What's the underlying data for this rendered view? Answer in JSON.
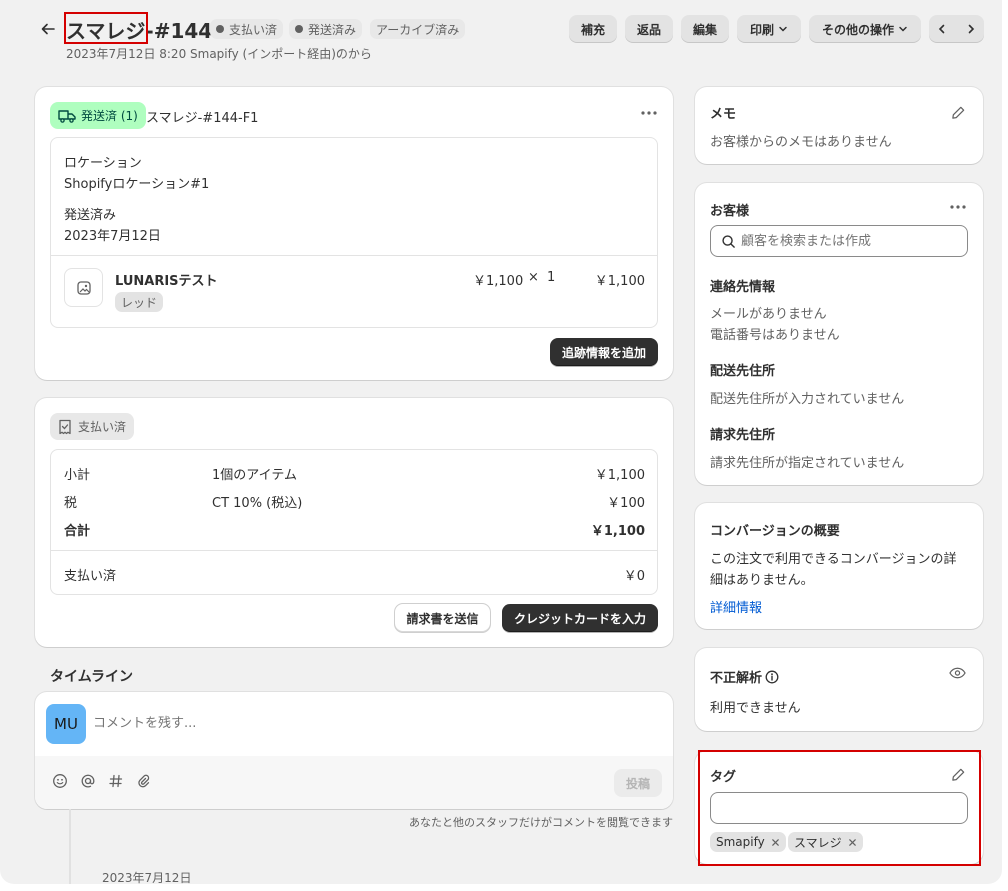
{
  "header": {
    "title_part1": "スマレジ",
    "title_part2": "-#144",
    "badges": [
      "支払い済",
      "発送済み",
      "アーカイブ済み"
    ],
    "subtitle": "2023年7月12日 8:20 Smapify (インポート経由)のから",
    "actions": {
      "restock": "補充",
      "return": "返品",
      "edit": "編集",
      "print": "印刷",
      "more": "その他の操作"
    }
  },
  "fulfillment": {
    "status_badge": "発送済 (1)",
    "fulfillment_id": "スマレジ-#144-F1",
    "location_label": "ロケーション",
    "location_value": "Shopifyロケーション#1",
    "shipped_label": "発送済み",
    "shipped_date": "2023年7月12日",
    "item": {
      "name": "LUNARISテスト",
      "variant": "レッド",
      "price": "￥1,100",
      "times": "×",
      "qty": "1",
      "total": "￥1,100"
    },
    "add_tracking": "追跡情報を追加"
  },
  "payment": {
    "status_badge": "支払い済",
    "rows": [
      {
        "label": "小計",
        "desc": "1個のアイテム",
        "amount": "￥1,100"
      },
      {
        "label": "税",
        "desc": "CT 10% (税込)",
        "amount": "￥100"
      },
      {
        "label": "合計",
        "desc": "",
        "amount": "￥1,100"
      }
    ],
    "paid_label": "支払い済",
    "paid_amount": "￥0",
    "send_invoice": "請求書を送信",
    "enter_card": "クレジットカードを入力"
  },
  "timeline": {
    "title": "タイムライン",
    "avatar_initials": "MU",
    "comment_placeholder": "コメントを残す...",
    "post": "投稿",
    "note": "あなたと他のスタッフだけがコメントを閲覧できます",
    "date": "2023年7月12日"
  },
  "memo": {
    "title": "メモ",
    "text": "お客様からのメモはありません"
  },
  "customer": {
    "title": "お客様",
    "search_placeholder": "顧客を検索または作成",
    "contact_title": "連絡先情報",
    "no_email": "メールがありません",
    "no_phone": "電話番号はありません",
    "shipping_title": "配送先住所",
    "shipping_text": "配送先住所が入力されていません",
    "billing_title": "請求先住所",
    "billing_text": "請求先住所が指定されていません"
  },
  "conversion": {
    "title": "コンバージョンの概要",
    "text_line1": "この注文で利用できるコンバージョンの詳",
    "text_line2": "細はありません。",
    "link": "詳細情報"
  },
  "fraud": {
    "title": "不正解析",
    "text": "利用できません"
  },
  "tags": {
    "title": "タグ",
    "input_value": "",
    "items": [
      "Smapify",
      "スマレジ"
    ]
  },
  "colors": {
    "highlight": "#d40000",
    "fulfilled_badge_bg": "#affebf",
    "fulfilled_badge_text": "#014b40",
    "link": "#005bd3",
    "avatar": "#64b5f6"
  }
}
